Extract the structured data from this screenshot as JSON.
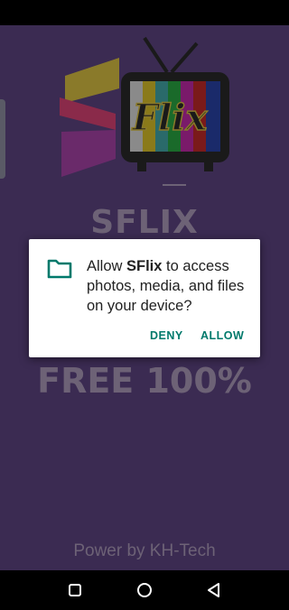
{
  "splash": {
    "logo_text": "Flix",
    "app_name": "SFLIX",
    "free_label": "FREE 100%",
    "power_label": "Power by KH-Tech"
  },
  "dialog": {
    "icon": "folder-icon",
    "message_prefix": "Allow ",
    "app_name": "SFlix",
    "message_suffix": " to access photos, media, and files on your device?",
    "deny_label": "DENY",
    "allow_label": "ALLOW",
    "accent_color": "#00796b"
  },
  "nav_bar": {
    "icons": [
      "recents-square-icon",
      "home-circle-icon",
      "back-triangle-icon"
    ]
  }
}
